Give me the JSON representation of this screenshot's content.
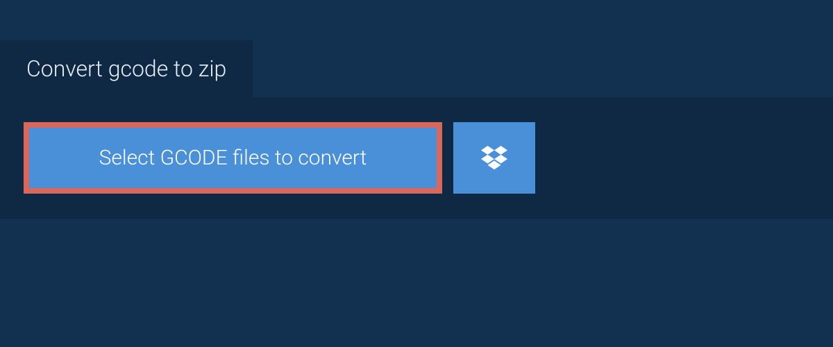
{
  "header": {
    "title": "Convert gcode to zip"
  },
  "actions": {
    "select_label": "Select GCODE files to convert"
  },
  "colors": {
    "bg_outer": "#12304f",
    "bg_panel": "#0f2843",
    "button_primary": "#4a90d9",
    "button_border": "#d9675a",
    "text_light": "#e8eef4"
  }
}
